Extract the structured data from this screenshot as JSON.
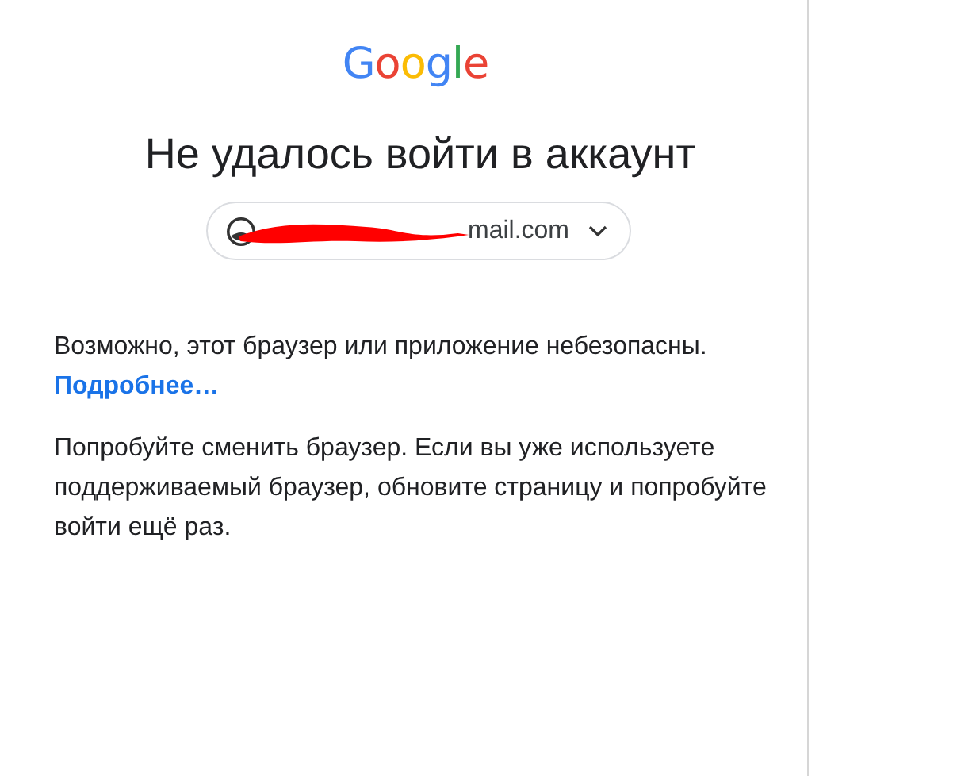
{
  "logo": {
    "text": "Google"
  },
  "title": "Не удалось войти в аккаунт",
  "account": {
    "email": "mail.com",
    "redacted": true
  },
  "messages": [
    {
      "text": "Возможно, этот браузер или приложение небезопасны.",
      "link": "Подробнее…"
    },
    {
      "text": "Попробуйте сменить браузер. Если вы уже используете поддерживаемый браузер, обновите страницу и попробуйте войти ещё раз."
    }
  ]
}
